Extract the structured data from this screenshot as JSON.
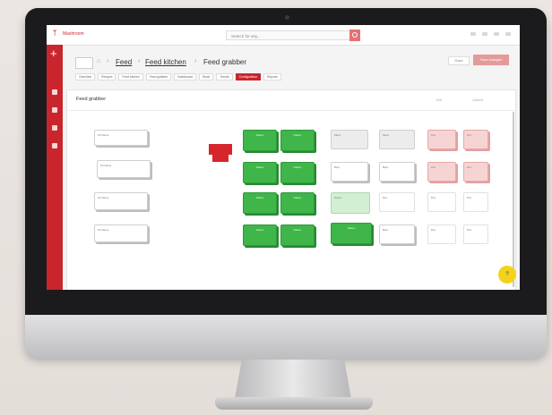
{
  "app": {
    "logo": "ᛉ",
    "logo_text": "Mashroom",
    "search_placeholder": "Search for any..."
  },
  "breadcrumb": {
    "items": [
      "Feed",
      "Feed kitchen",
      "Feed grabber"
    ]
  },
  "header_buttons": {
    "secondary": "Share",
    "primary": "Save changes"
  },
  "tabs": [
    "Overview",
    "Recipes",
    "Feed kitchen",
    "Feed grabber",
    "Dashboard",
    "Stock",
    "Trends",
    "Configuration",
    "Reports"
  ],
  "active_tab_index": 7,
  "panel": {
    "title": "Feed grabber",
    "actions": [
      "Edit",
      "Options"
    ]
  },
  "nodes": {
    "left_boxes": [
      "Kit Name",
      "Kit Name",
      "Kit Name",
      "Kit Name"
    ],
    "green_boxes": [
      "Ration",
      "Ration",
      "Ration",
      "Ration",
      "Ration",
      "Ration",
      "Ration",
      "Ration"
    ],
    "green_right": [
      "Ration",
      "Ration"
    ],
    "gray_boxes": [
      "Mixer",
      "Mixer"
    ],
    "white_mid": [
      "Barn",
      "Barn",
      "Barn"
    ],
    "pink_boxes": [
      "Pen",
      "Pen",
      "Pen",
      "Pen"
    ],
    "plain_boxes": [
      "Pen",
      "Pen",
      "Pen",
      "Pen",
      "Pen",
      "Pen"
    ]
  },
  "help_label": "?",
  "colors": {
    "brand": "#c8262c",
    "green": "#3fb54a",
    "help": "#f3d21b"
  }
}
